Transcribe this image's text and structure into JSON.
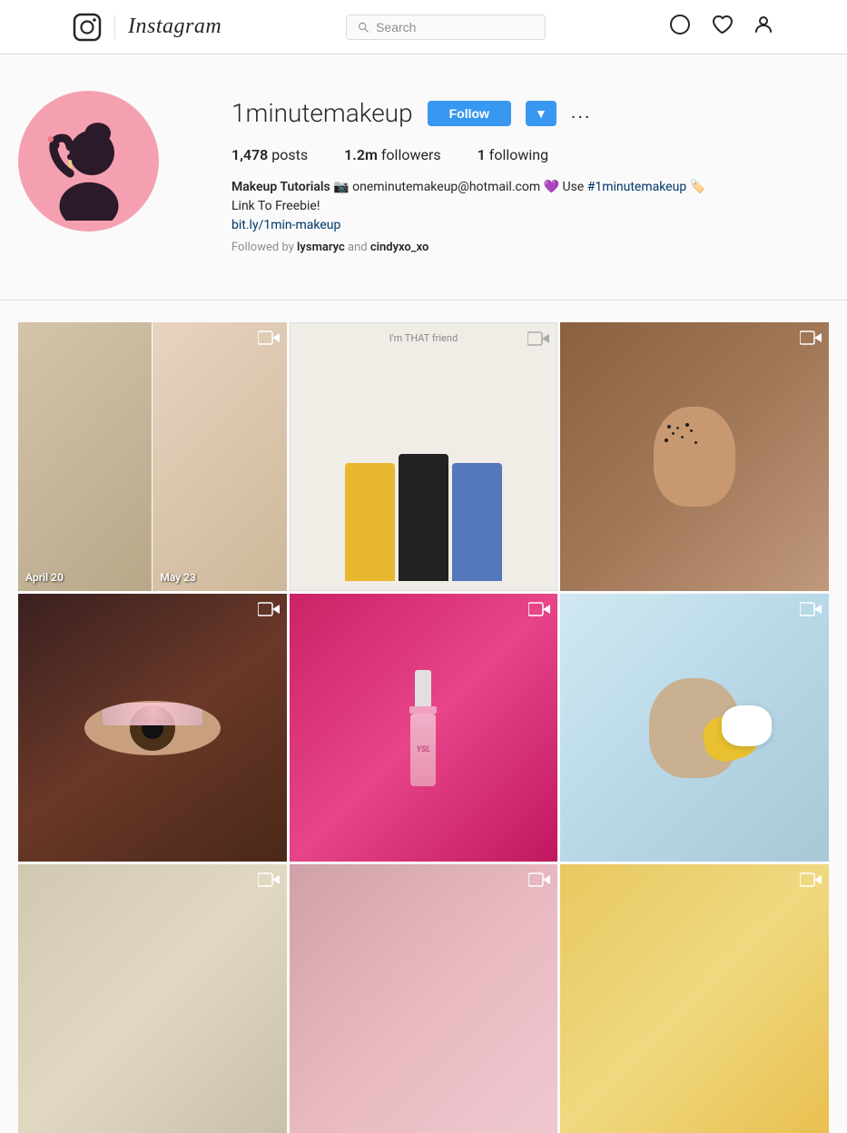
{
  "header": {
    "logo_alt": "Instagram",
    "search_placeholder": "Search",
    "icons": {
      "compass": "⊕",
      "heart": "♡",
      "person": "👤"
    }
  },
  "profile": {
    "username": "1minutemakeup",
    "follow_label": "Follow",
    "dropdown_label": "▼",
    "more_label": "...",
    "stats": {
      "posts_count": "1,478",
      "posts_label": "posts",
      "followers_count": "1.2m",
      "followers_label": "followers",
      "following_count": "1",
      "following_label": "following"
    },
    "bio": {
      "title": "Makeup Tutorials",
      "email": "oneminutemakeup@hotmail.com",
      "hashtag": "#1minutemakeup",
      "cta": "Link To Freebie!",
      "link": "bit.ly/1min-makeup",
      "link_href": "#"
    },
    "followed_by_label": "Followed by",
    "followed_by_users": [
      "lysmaryc",
      "cindyxo_xo"
    ]
  },
  "posts": [
    {
      "id": "p1",
      "type": "video",
      "label": "",
      "overlay": "",
      "bg": "post-bg-1"
    },
    {
      "id": "p2",
      "type": "video",
      "label": "I'm THAT friend",
      "overlay": "I'm THAT friend",
      "bg": "post-bg-2"
    },
    {
      "id": "p3",
      "type": "video",
      "label": "",
      "overlay": "",
      "bg": "post-bg-3"
    },
    {
      "id": "p4",
      "type": "video",
      "label": "",
      "overlay": "",
      "bg": "post-bg-4"
    },
    {
      "id": "p5",
      "type": "video",
      "label": "",
      "overlay": "",
      "bg": "post-bg-5"
    },
    {
      "id": "p6",
      "type": "video",
      "label": "",
      "overlay": "",
      "bg": "post-bg-6"
    },
    {
      "id": "p7",
      "type": "video",
      "label": "",
      "overlay": "",
      "bg": "post-bg-7"
    },
    {
      "id": "p8",
      "type": "video",
      "label": "",
      "overlay": "",
      "bg": "post-bg-8"
    },
    {
      "id": "p9",
      "type": "video",
      "label": "",
      "overlay": "",
      "bg": "post-bg-9"
    }
  ]
}
